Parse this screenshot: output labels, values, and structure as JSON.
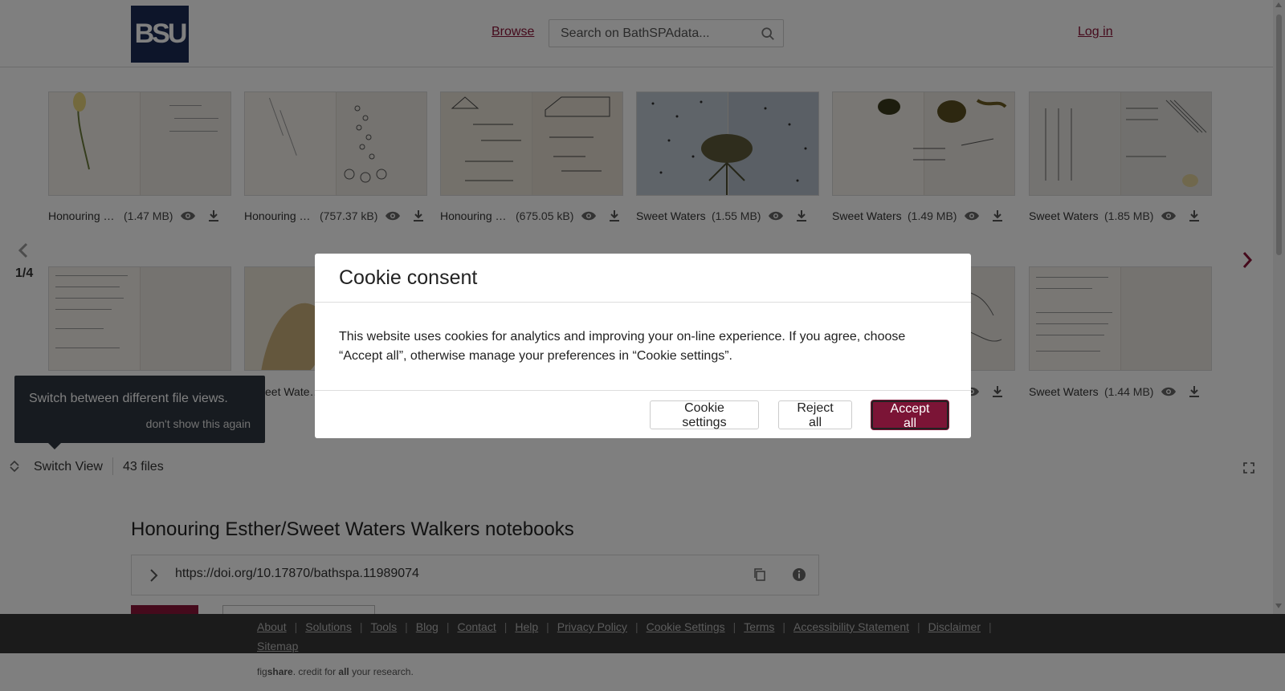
{
  "header": {
    "logo_text": "BSU",
    "browse_label": "Browse",
    "search_placeholder": "Search on BathSPAdata...",
    "login_label": "Log in"
  },
  "gallery": {
    "pager": "1/4",
    "row1": [
      {
        "name": "Honouring Esther",
        "size": "(1.47 MB)"
      },
      {
        "name": "Honouring Esther",
        "size": "(757.37 kB)"
      },
      {
        "name": "Honouring Esther",
        "size": "(675.05 kB)"
      },
      {
        "name": "Sweet Waters",
        "size": "(1.55 MB)"
      },
      {
        "name": "Sweet Waters",
        "size": "(1.49 MB)"
      },
      {
        "name": "Sweet Waters",
        "size": "(1.85 MB)"
      }
    ],
    "row2_partial_caption": "eet Wate…",
    "row2_last": {
      "name": "Sweet Waters",
      "size": "(1.44 MB)"
    }
  },
  "tooltip": {
    "text": "Switch between different file views.",
    "dismiss": "don't show this again"
  },
  "viewbar": {
    "switch_label": "Switch View",
    "files_count": "43 files"
  },
  "item": {
    "title": "Honouring Esther/Sweet Waters Walkers notebooks",
    "doi": "https://doi.org/10.17870/bathspa.11989074"
  },
  "footer": {
    "links": [
      "About",
      "Solutions",
      "Tools",
      "Blog",
      "Contact",
      "Help",
      "Privacy Policy",
      "Cookie Settings",
      "Terms",
      "Accessibility Statement",
      "Disclaimer",
      "Sitemap"
    ],
    "credit_fig": "fig",
    "credit_share": "share",
    "credit_mid": ". credit for ",
    "credit_all": "all",
    "credit_end": " your research."
  },
  "cookie_modal": {
    "title": "Cookie consent",
    "body": "This website uses cookies for analytics and improving your on-line experience. If you agree, choose “Accept all”, otherwise manage your preferences in “Cookie settings”.",
    "settings_label": "Cookie settings",
    "reject_label": "Reject all",
    "accept_label": "Accept all"
  },
  "colors": {
    "brand": "#8a1538",
    "logo_bg": "#1b2a55",
    "footer_dark": "#363636"
  }
}
